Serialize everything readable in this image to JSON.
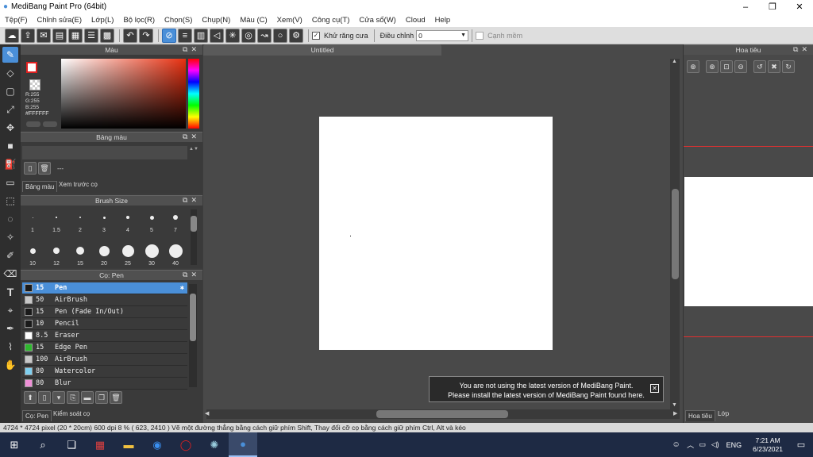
{
  "window": {
    "title": "MediBang Paint Pro (64bit)",
    "minimize": "–",
    "maximize": "❐",
    "close": "✕"
  },
  "menu": [
    "Tệp(F)",
    "Chỉnh sửa(E)",
    "Lớp(L)",
    "Bộ lọc(R)",
    "Chọn(S)",
    "Chụp(N)",
    "Màu (C)",
    "Xem(V)",
    "Công cụ(T)",
    "Cửa sổ(W)",
    "Cloud",
    "Help"
  ],
  "toolbar": {
    "antialias_label": "Khử răng cưa",
    "adjust_label": "Điều chỉnh",
    "adjust_value": "0",
    "edge_label": "Cạnh mềm"
  },
  "color_panel": {
    "title": "Màu",
    "r": "R:255",
    "g": "G:255",
    "b": "B:255",
    "hex": "#FFFFFF"
  },
  "palette_panel": {
    "title": "Bảng màu",
    "dashes": "---",
    "tab1": "Bảng màu",
    "tab2": "Xem trước cọ"
  },
  "brushsize_panel": {
    "title": "Brush Size",
    "sizes_row1": [
      "1",
      "1.5",
      "2",
      "3",
      "4",
      "5",
      "7"
    ],
    "sizes_row2": [
      "10",
      "12",
      "15",
      "20",
      "25",
      "30",
      "40"
    ]
  },
  "brush_panel": {
    "title": "Cọ: Pen",
    "brushes": [
      {
        "size": "15",
        "name": "Pen",
        "color": "#1a1a1a",
        "selected": true
      },
      {
        "size": "50",
        "name": "AirBrush",
        "color": "#c8c8c8"
      },
      {
        "size": "15",
        "name": "Pen (Fade In/Out)",
        "color": "#1a1a1a"
      },
      {
        "size": "10",
        "name": "Pencil",
        "color": "#1a1a1a"
      },
      {
        "size": "8.5",
        "name": "Eraser",
        "color": "#ffffff"
      },
      {
        "size": "15",
        "name": "Edge Pen",
        "color": "#2eb82e"
      },
      {
        "size": "100",
        "name": "AirBrush",
        "color": "#c8c8c8"
      },
      {
        "size": "80",
        "name": "Watercolor",
        "color": "#7fd0f0"
      },
      {
        "size": "80",
        "name": "Blur",
        "color": "#f090d8"
      }
    ],
    "tab1": "Cọ: Pen",
    "tab2": "Kiểm soát cọ"
  },
  "document": {
    "tab": "Untitled"
  },
  "notice": {
    "line1": "You are not using the latest version of MediBang Paint.",
    "line2": "Please install the latest version of MediBang Paint found here."
  },
  "navigator": {
    "title": "Hoa tiêu",
    "tab1": "Hoa tiêu",
    "tab2": "Lớp"
  },
  "status": "4724 * 4724 pixel  (20 * 20cm)  600 dpi  8 %  ( 623, 2410 )  Vẽ một đường thẳng bằng cách giữ phím Shift, Thay đổi cỡ cọ bằng cách giữ phím Ctrl, Alt và kéo",
  "taskbar": {
    "lang": "ENG",
    "time": "7:21 AM",
    "date": "6/23/2021"
  }
}
